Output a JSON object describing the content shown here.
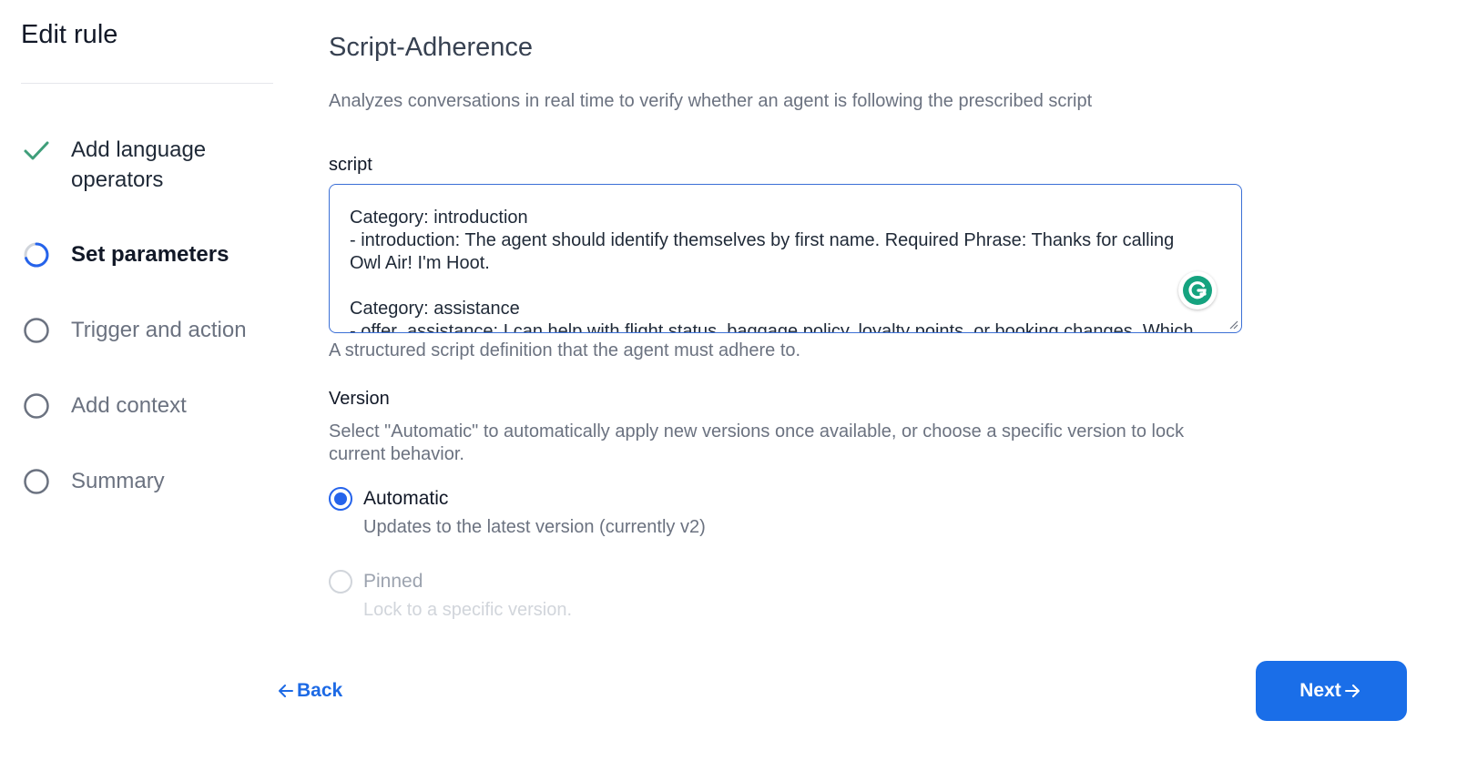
{
  "page_title": "Edit rule",
  "steps": [
    {
      "label": "Add language operators",
      "status": "done"
    },
    {
      "label": "Set parameters",
      "status": "active"
    },
    {
      "label": "Trigger and action",
      "status": "pending"
    },
    {
      "label": "Add context",
      "status": "pending"
    },
    {
      "label": "Summary",
      "status": "pending"
    }
  ],
  "rule": {
    "title": "Script-Adherence",
    "description": "Analyzes conversations in real time to verify whether an agent is following the prescribed script"
  },
  "script_field": {
    "label": "script",
    "value": "Category: introduction\n- introduction: The agent should identify themselves by first name. Required Phrase: Thanks for calling Owl Air! I'm Hoot.\n\nCategory: assistance\n- offer_assistance: I can help with flight status, baggage policy, loyalty points, or booking changes. Which",
    "help_text": "A structured script definition that the agent must adhere to."
  },
  "version": {
    "label": "Version",
    "description": "Select \"Automatic\" to automatically apply new versions once available, or choose a specific version to lock current behavior.",
    "options": [
      {
        "label": "Automatic",
        "sub": "Updates to the latest version (currently v2)",
        "selected": true
      },
      {
        "label": "Pinned",
        "sub": "Lock to a specific version.",
        "selected": false
      }
    ]
  },
  "nav": {
    "back_label": "Back",
    "next_label": "Next"
  },
  "colors": {
    "accent": "#1a6ee8",
    "check": "#3f9e7a"
  },
  "icons": {
    "done": "check-icon",
    "active": "spinner-icon",
    "pending": "circle-icon",
    "back": "arrow-left-icon",
    "next": "arrow-right-icon",
    "grammarly": "grammarly-icon"
  }
}
